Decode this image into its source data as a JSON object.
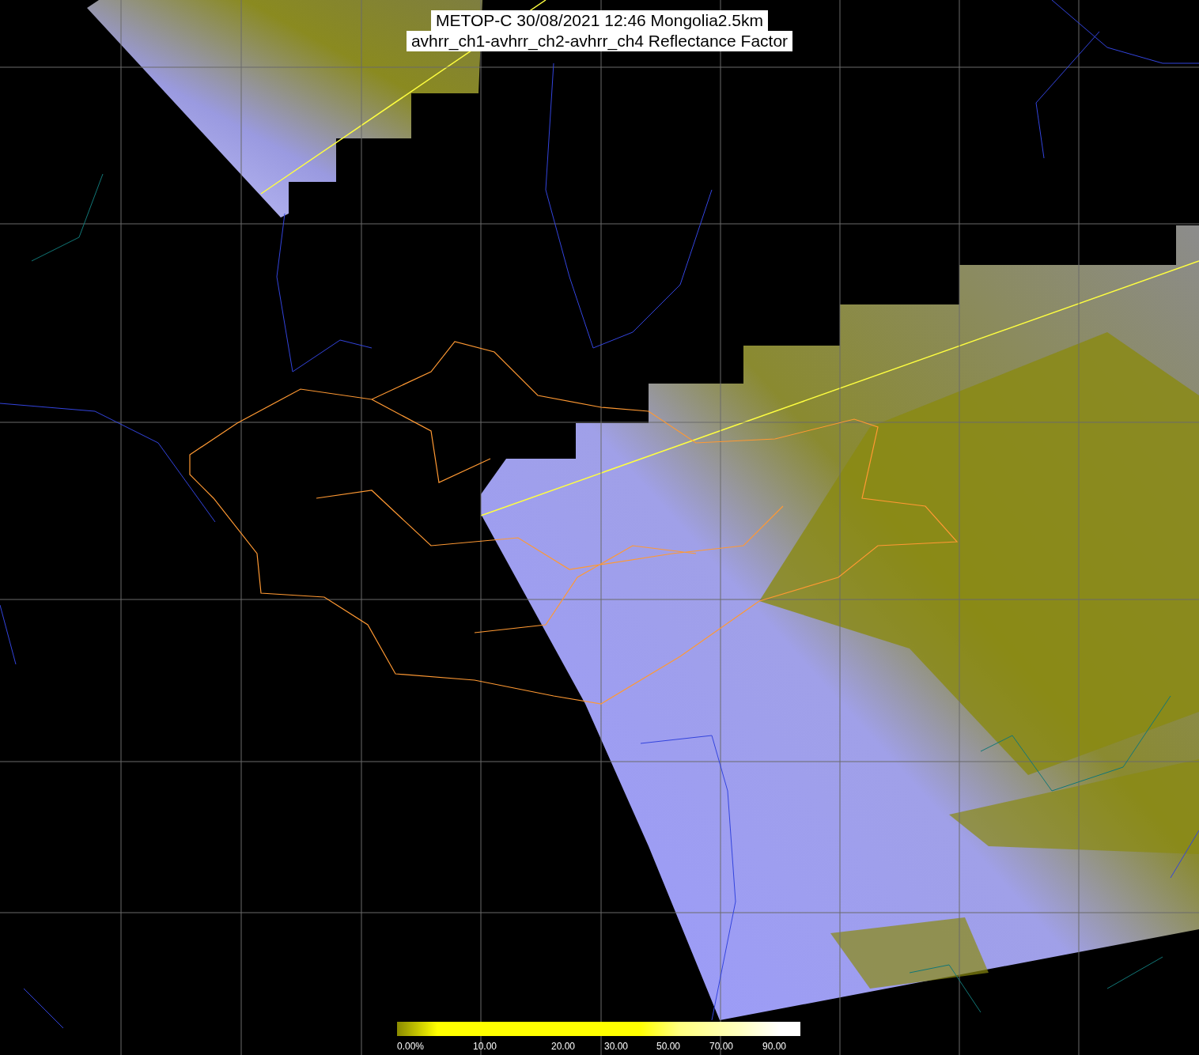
{
  "title": {
    "lines": [
      "METOP-C 30/08/2021 12:46 Mongolia2.5km",
      "avhrr_ch1-avhrr_ch2-avhrr_ch4 Reflectance Factor"
    ]
  },
  "colorbar": {
    "labels": [
      "0.00%",
      "10.00",
      "20.00",
      "30.00",
      "50.00",
      "70.00",
      "90.00"
    ]
  }
}
